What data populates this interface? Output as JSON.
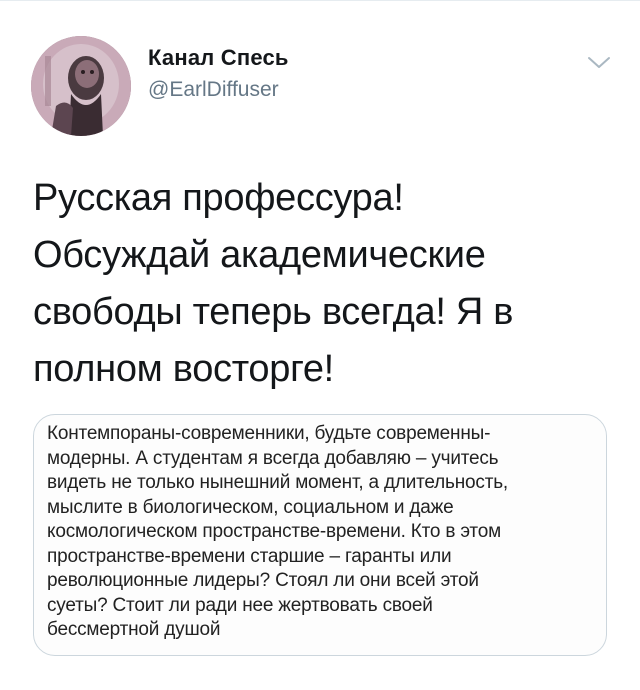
{
  "author": {
    "name": "Канал Спесь",
    "handle": "@EarlDiffuser"
  },
  "icons": {
    "menu": "chevron-down-icon"
  },
  "tweet": {
    "text": "Русская профессура!\nОбсуждай академические\nсвободы теперь всегда! Я в\nполном восторге!"
  },
  "media": {
    "text": "Контемпораны-современники, будьте современны-\nмодерны. А студентам я всегда добавляю – учитесь\nвидеть не только нынешний момент, а длительность,\nмыслите в биологическом, социальном и даже\nкосмологическом пространстве-времени. Кто в этом\nпространстве-времени старшие – гаранты или\nреволюционные лидеры? Стоял ли они всей этой\nсуеты? Стоит ли ради нее жертвовать своей\nбессмертной душой"
  },
  "colors": {
    "text_primary": "#14171a",
    "text_secondary": "#657786",
    "border": "#ccd6dd"
  }
}
